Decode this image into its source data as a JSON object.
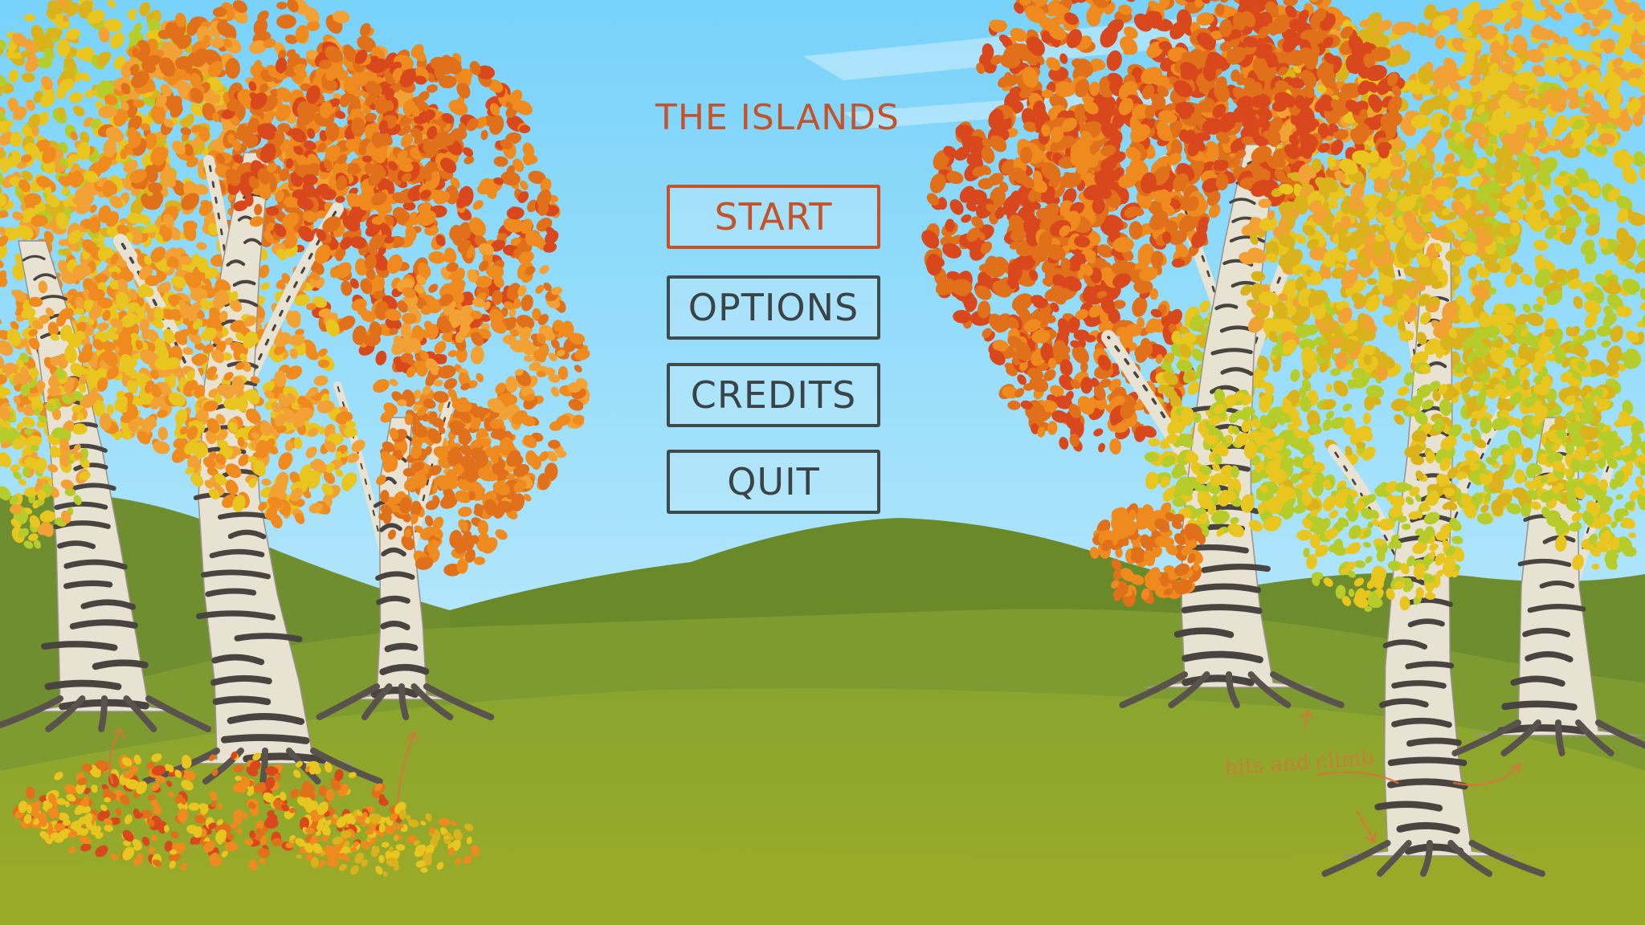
{
  "game": {
    "title": "THE ISLANDS"
  },
  "menu": {
    "items": [
      {
        "label": "START",
        "selected": true
      },
      {
        "label": "OPTIONS",
        "selected": false
      },
      {
        "label": "CREDITS",
        "selected": false
      },
      {
        "label": "QUIT",
        "selected": false
      }
    ]
  },
  "sketch_notes": {
    "text": "hits and climb"
  },
  "colors": {
    "sky_top": "#7cd6fb",
    "sky_bottom": "#cfeefa",
    "hill_far": "#6a8a2e",
    "hill_mid": "#7d9a32",
    "grass": "#96ab2c",
    "title": "#c4532a",
    "accent": "#c4532a",
    "button_border": "#3f4a4c",
    "button_text": "#3a4446",
    "bark": "#e8e2d2",
    "bark_marks": "#4a4440",
    "leaf_red": "#d9481c",
    "leaf_orange": "#ee8a1e",
    "leaf_yellow": "#e9c61f",
    "leaf_green": "#b5cc2a"
  }
}
